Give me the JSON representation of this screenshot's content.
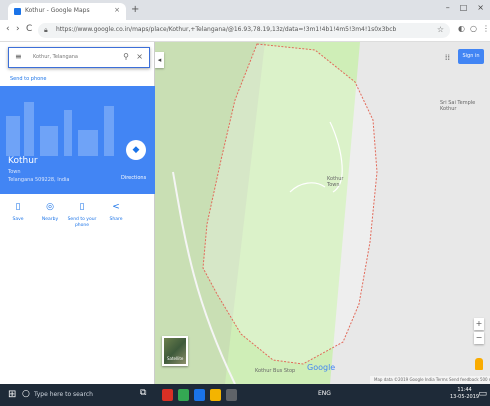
{
  "browser": {
    "tab_title": "Kothur - Google Maps",
    "tab_close": "×",
    "new_tab": "+",
    "minimize": "–",
    "maximize": "□",
    "close": "×",
    "back": "‹",
    "forward": "›",
    "reload": "C",
    "url": "https://www.google.co.in/maps/place/Kothur,+Telangana/@16.93,78.19,13z/data=!3m1!4b1!4m5!3m4!1s0x3bcb",
    "star": "☆"
  },
  "panel": {
    "search_value": "Kothur, Telangana",
    "search_hint": "Send to phone",
    "place_name": "Kothur",
    "place_type": "Town",
    "place_address": "Telangana 509228, India",
    "directions_label": "Directions",
    "actions": [
      {
        "icon": "▯",
        "label": "Save"
      },
      {
        "icon": "◎",
        "label": "Nearby"
      },
      {
        "icon": "▯",
        "label": "Send to your phone"
      },
      {
        "icon": "<",
        "label": "Share"
      }
    ]
  },
  "map": {
    "signin_label": "Sign in",
    "labels": [
      {
        "text": "Kothur",
        "sub": "Town"
      },
      {
        "text": "Sri Sai Temple",
        "sub": "Kothur"
      },
      {
        "text": "Kothur Bus Stop",
        "sub": ""
      }
    ],
    "satellite_label": "Satellite",
    "zoom_in": "+",
    "zoom_out": "−",
    "google": "Google",
    "footer": "Map data ©2019 Google  India  Terms  Send feedback  500 m"
  },
  "taskbar": {
    "search_placeholder": "Type here to search",
    "tray": "ENG",
    "time": "11:44",
    "date": "13-05-2019"
  },
  "colors": {
    "brand_blue": "#4285f4",
    "green_area": "#c8e6b0",
    "boundary": "#e26a5a"
  }
}
